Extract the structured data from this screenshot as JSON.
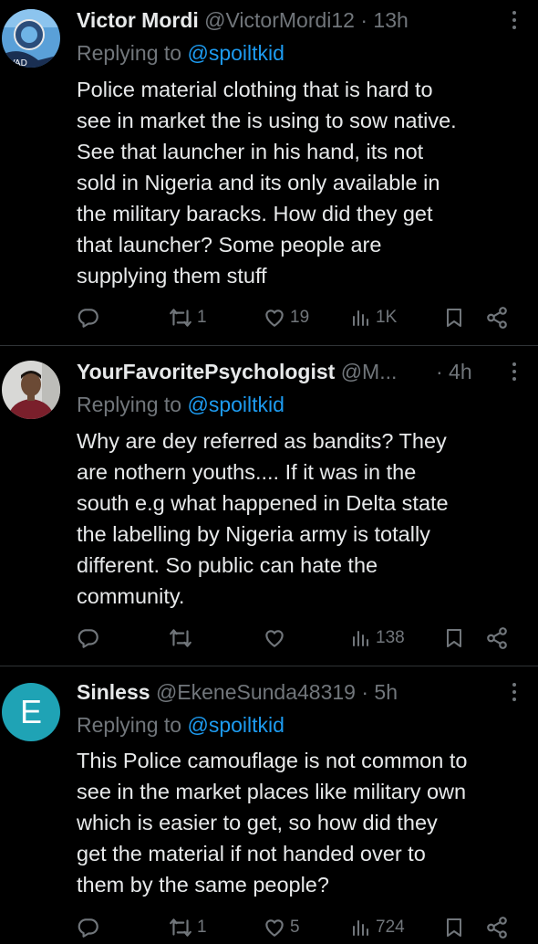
{
  "tweets": [
    {
      "name": "Victor Mordi",
      "handle": "@VictorMordi12",
      "time": "· 13h",
      "replying_label": "Replying to",
      "replying_to": "@spoiltkid",
      "text": "Police material clothing that is hard to\nsee in market the is using to sow native.\nSee that launcher in his hand, its not\nsold in Nigeria and its only available in\nthe military baracks. How did they get\nthat launcher? Some people are\nsupplying them stuff",
      "retweets": "1",
      "likes": "19",
      "views": "1K"
    },
    {
      "name": "YourFavoritePsychologist",
      "handle": "@M...",
      "time": "· 4h",
      "replying_label": "Replying to",
      "replying_to": "@spoiltkid",
      "text": "Why are dey referred as bandits? They\nare nothern youths.... If it was in the\nsouth e.g what happened in Delta state\nthe labelling by Nigeria army is totally\ndifferent. So public can hate the\ncommunity.",
      "retweets": "",
      "likes": "",
      "views": "138"
    },
    {
      "name": "Sinless",
      "handle": "@EkeneSunda48319",
      "time": "· 5h",
      "avatar_letter": "E",
      "replying_label": "Replying to",
      "replying_to": "@spoiltkid",
      "text": "This Police camouflage is not common to\nsee in the market places like military own\nwhich is easier to get, so how did they\nget the material if not handed over to\nthem by the same people?",
      "retweets": "1",
      "likes": "5",
      "views": "724"
    }
  ],
  "icons": {
    "reply": "reply-icon",
    "retweet": "retweet-icon",
    "like": "heart-icon",
    "views": "views-icon",
    "bookmark": "bookmark-icon",
    "share": "share-icon",
    "more": "more-icon"
  },
  "colors": {
    "background": "#000000",
    "text": "#e7e9ea",
    "muted": "#71767b",
    "link": "#1d9bf0",
    "avatar_e": "#1fa3b5"
  }
}
